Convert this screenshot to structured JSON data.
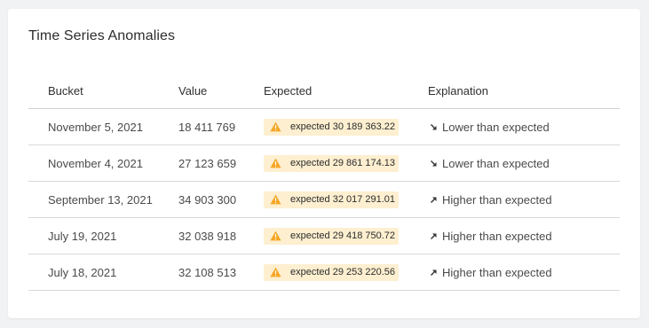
{
  "title": "Time Series Anomalies",
  "columns": {
    "bucket": "Bucket",
    "value": "Value",
    "expected": "Expected",
    "explanation": "Explanation"
  },
  "rows": [
    {
      "bucket": "November 5, 2021",
      "value": "18 411 769",
      "expected": "expected 30 189 363.22",
      "explanation": "Lower than expected",
      "trend_icon": "arrow-down-right-icon"
    },
    {
      "bucket": "November 4, 2021",
      "value": "27 123 659",
      "expected": "expected 29 861 174.13",
      "explanation": "Lower than expected",
      "trend_icon": "arrow-down-right-icon"
    },
    {
      "bucket": "September 13, 2021",
      "value": "34 903 300",
      "expected": "expected 32 017 291.01",
      "explanation": "Higher than expected",
      "trend_icon": "arrow-up-right-icon"
    },
    {
      "bucket": "July 19, 2021",
      "value": "32 038 918",
      "expected": "expected 29 418 750.72",
      "explanation": "Higher than expected",
      "trend_icon": "arrow-up-right-icon"
    },
    {
      "bucket": "July 18, 2021",
      "value": "32 108 513",
      "expected": "expected 29 253 220.56",
      "explanation": "Higher than expected",
      "trend_icon": "arrow-up-right-icon"
    }
  ],
  "colors": {
    "badge_bg": "#fdefd0",
    "warning": "#f5a623"
  }
}
